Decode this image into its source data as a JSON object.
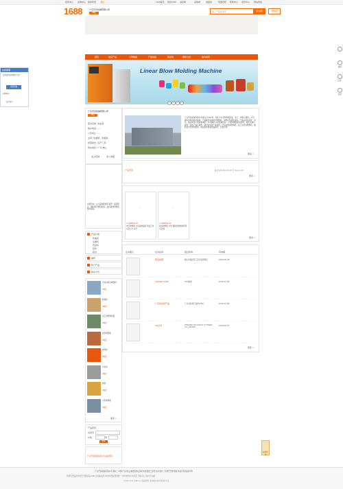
{
  "topbar": {
    "links": [
      "卖家中心",
      "采购中心",
      "我的阿里",
      "消息"
    ],
    "right_links": [
      "1688首页",
      "我的1688",
      "进货单",
      "采购单",
      "收藏夹",
      "阿里旺旺",
      "帮助中心",
      "卖家中心",
      "网站导航"
    ]
  },
  "header": {
    "logo": "1688",
    "shop_name": "广东乐善机械有限公司",
    "years": "18年",
    "search_placeholder": "输入产品关键字",
    "search_all": "搜全网",
    "search_shop": "搜本店"
  },
  "nav": [
    "首页",
    "供应产品",
    "公司档案",
    "产品动态",
    "联系我",
    "服务方式",
    "站内资料"
  ],
  "banner": {
    "title": "Linear Blow Molding Machine",
    "pages": [
      "1",
      "2",
      "3",
      "4"
    ]
  },
  "sidebar_float": {
    "title": "在线客服",
    "line1": "没有找到您需要的产品?",
    "button": "立即咨询",
    "line2": "在线时间",
    "footer": "联系我们"
  },
  "company_card": {
    "title": "广东乐善机械有限公司",
    "level": "18年",
    "info": [
      "首次采购 / 新会员",
      "联系电话 ——",
      "公司成立 ——",
      "主营 / 吹塑机、吹瓶机",
      "经营模式 / 生产厂家",
      "所在地区 / 广东 佛山"
    ],
    "btn_contact": "进入旺铺",
    "btn_fav": "加入收藏"
  },
  "about": {
    "text": "广东乐善机械有限公司成立于1997年，专注于中空吹塑机研发、生产、销售与服务。公司拥有多年的技术积累，产品覆盖各类挤出吹塑机、注吹机及配套设备，产品远销东南亚、中东、欧美等多个国家和地区。公司秉承“以质量求生存、以创新求发展”的理念，致力为客户提供一流的产品与服务。我们的主要产品包括：全自动线性吹塑机、双工位挤出吹塑机、储料式大型吹塑机等。欢迎各界朋友莅临指导、洽谈合作。",
    "more": "更多 >"
  },
  "news": {
    "title": "广东乐善",
    "date": "截止时间 2021-08-18 至 2021-10-20",
    "more": "更多 >"
  },
  "products": [
    {
      "price": "¥ 1658000.00",
      "name": "中空吹塑机 全自动吹瓶机 单双工位可选 1.5-12升"
    },
    {
      "price": "¥ 1388000.00",
      "name": "挤出吹塑机 大型 储料式吹塑成型机 可定制"
    }
  ],
  "products_more": "更多 >",
  "certs": {
    "headers": [
      "证书图片",
      "证书名称",
      "发证机构",
      "有效期"
    ],
    "rows": [
      {
        "name": "营业执照",
        "org": "佛山市顺德区工商行政管理局",
        "date": "2050-06-28"
      },
      {
        "name": "ISO9001:2008",
        "org": "SGS集团",
        "date": "2019-11-18"
      },
      {
        "name": "广东省名牌产品",
        "org": "广东省名牌产品评价中心",
        "date": "2019-12-28"
      },
      {
        "name": "CE证书",
        "org": "STEPHEN TECHNICAL SYSTEMS CO.,LIMITED",
        "date": "2019-05-07"
      }
    ],
    "more": "更多 >"
  },
  "left_text": "免费咨询：以上采购需求不满足？请您留言，我们将尽快回复您；如有其他问题请随时联系。",
  "left_categories": {
    "title": "产品分类",
    "items": [
      "吹瓶机",
      "注塑机",
      "挤出机",
      "配件",
      "模具"
    ]
  },
  "left_links": [
    "推荐",
    "热门产品",
    "联系方式"
  ],
  "left_products": [
    {
      "name": "全自动挤出吹塑机",
      "price": "¥电议"
    },
    {
      "name": "吹瓶机",
      "price": "¥电议"
    },
    {
      "name": "双工位吹塑机组",
      "price": "¥电议"
    },
    {
      "name": "挤出吹塑机",
      "price": "¥电议"
    },
    {
      "name": "注吹机",
      "price": "¥电议"
    },
    {
      "name": "全自动",
      "price": "¥电议"
    },
    {
      "name": "吹塑",
      "price": "¥电议"
    },
    {
      "name": "大型吹塑机",
      "price": "¥电议"
    }
  ],
  "left_more": "更多 >",
  "search_box": {
    "title": "产品搜索",
    "label1": "关键词",
    "label2": "价格",
    "to": "到",
    "button": "搜索"
  },
  "left_bottom": "广东乐善机械有限公司 版权所有",
  "right_tools": [
    "客服",
    "反馈",
    "顶部"
  ],
  "float_btn": "在线咨询",
  "footer": {
    "line1": "广东乐善机械有限公司  地址：中国 广东 佛山 顺德区杏坛镇齐杏居委会工业区  技术支持：阿里巴巴中国站  免责声明  版权声明",
    "line2": "阿里巴巴集团  阿里巴巴国际站  1688  全球速卖通  淘宝网  天猫  聚划算  一淘  阿里妈妈  阿里云  飞猪  钉钉  支付宝  优酷",
    "line3": "©1999-2017 1688.com 版权所有  增值电信业务经营许可证"
  }
}
